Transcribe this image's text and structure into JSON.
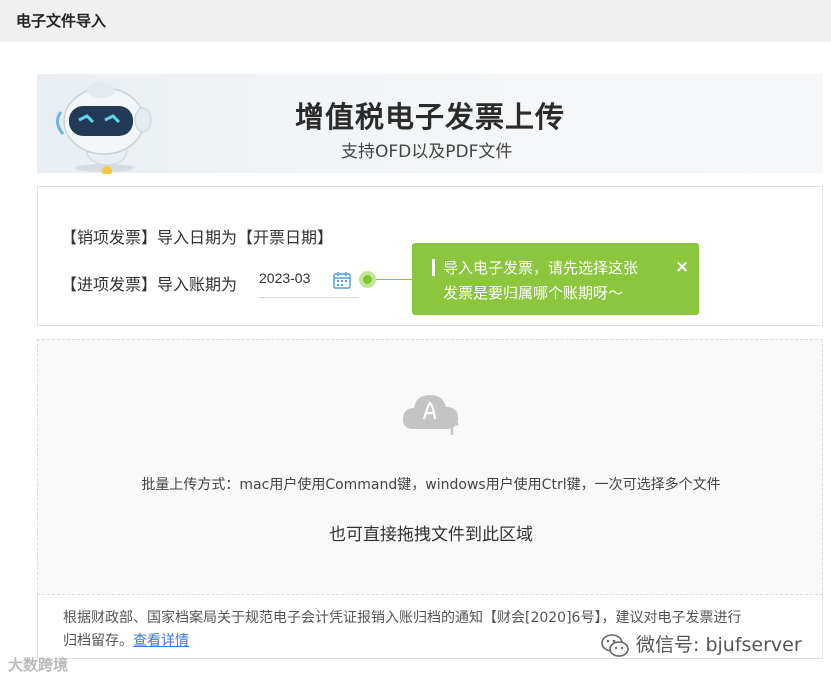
{
  "header": {
    "title": "电子文件导入"
  },
  "banner": {
    "title": "增值税电子发票上传",
    "subtitle": "支持OFD以及PDF文件",
    "mascot_icon": "robot-mascot-icon"
  },
  "import": {
    "sales_line": "【销项发票】导入日期为【开票日期】",
    "purchase_label": "【进项发票】导入账期为",
    "period_value": "2023-03",
    "calendar_icon": "calendar-icon"
  },
  "tooltip": {
    "line1": "导入电子发票，请先选择这张",
    "line2": "发票是要归属哪个账期呀～",
    "close": "×",
    "color": "#8cc63f"
  },
  "dropzone": {
    "upload_icon": "cloud-upload-icon",
    "batch_text": "批量上传方式：mac用户使用Command键，windows用户使用Ctrl键，一次可选择多个文件",
    "drag_text": "也可直接拖拽文件到此区域"
  },
  "notice": {
    "line1": "根据财政部、国家档案局关于规范电子会计凭证报销入账归档的通知【财会[2020]6号】，建议对电子发票进行",
    "line2_prefix": "归档留存。",
    "link": "查看详情",
    "link_color": "#3a7bd5"
  },
  "watermarks": {
    "left": "大数跨境",
    "right": "微信号: bjufserver"
  }
}
